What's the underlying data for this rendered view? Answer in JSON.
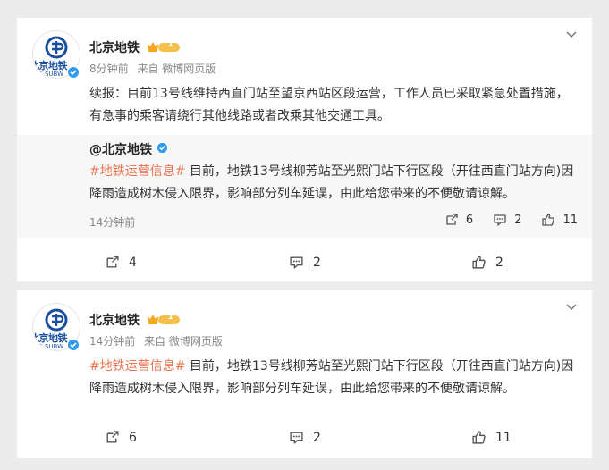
{
  "posts": [
    {
      "author": "北京地铁",
      "level": "1",
      "avatar_brand": "北京地铁",
      "avatar_sub": "ING SUBW",
      "time": "8分钟前",
      "source": "来自 微博网页版",
      "text": "续报：目前13号线维持西直门站至望京西站区段运营，工作人员已采取紧急处置措施，有急事的乘客请绕行其他线路或者改乘其他交通工具。",
      "quote": {
        "author": "@北京地铁",
        "hashtag": "#地铁运营信息#",
        "text": " 目前，地铁13号线柳芳站至光熙门站下行区段（开往西直门站方向)因降雨造成树木侵入限界，影响部分列车延误，由此给您带来的不便敬请谅解。",
        "time": "14分钟前",
        "reposts": "6",
        "comments": "2",
        "likes": "11"
      },
      "reposts": "4",
      "comments": "2",
      "likes": "2"
    },
    {
      "author": "北京地铁",
      "level": "1",
      "avatar_brand": "北京地铁",
      "avatar_sub": "ING SUBW",
      "time": "14分钟前",
      "source": "来自 微博网页版",
      "hashtag": "#地铁运营信息#",
      "text": " 目前，地铁13号线柳芳站至光熙门站下行区段（开往西直门站方向)因降雨造成树木侵入限界，影响部分列车延误，由此给您带来的不便敬请谅解。",
      "reposts": "6",
      "comments": "2",
      "likes": "11"
    }
  ],
  "colors": {
    "accent": "#eb7350",
    "brand": "#1a4fa0",
    "verified": "#2f9bef",
    "crown": "#f5a623"
  },
  "icons": [
    "chevron-down-icon",
    "metro-logo-icon",
    "verified-icon",
    "crown-icon",
    "repost-icon",
    "comment-icon",
    "like-icon"
  ]
}
